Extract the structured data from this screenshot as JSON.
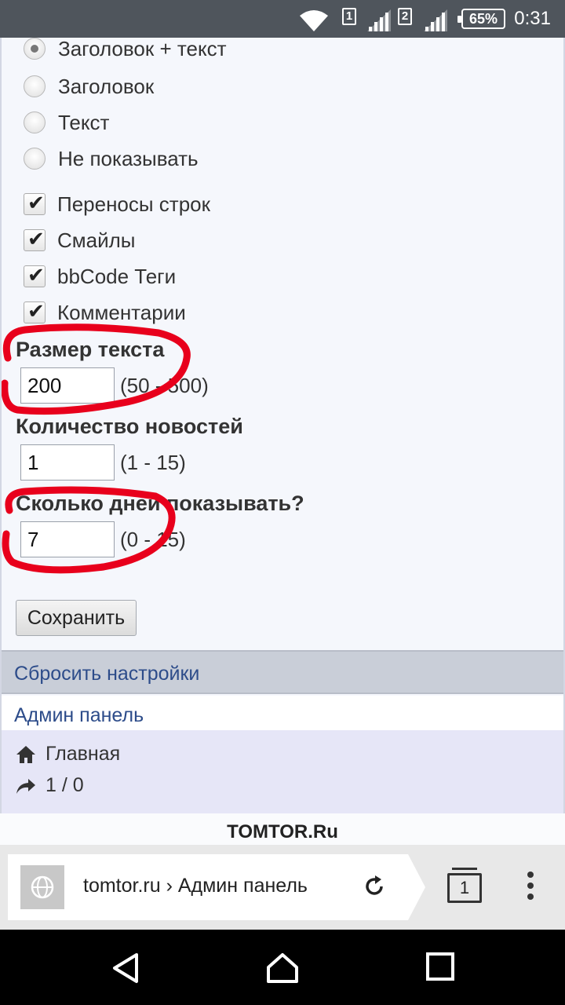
{
  "status_bar": {
    "time": "0:31",
    "battery": "65%",
    "sim1": "1",
    "sim2": "2"
  },
  "display_mode": {
    "options": [
      {
        "label": "Заголовок + текст",
        "checked": true
      },
      {
        "label": "Заголовок",
        "checked": false
      },
      {
        "label": "Текст",
        "checked": false
      },
      {
        "label": "Не показывать",
        "checked": false
      }
    ]
  },
  "options": {
    "items": [
      {
        "label": "Переносы строк",
        "checked": true
      },
      {
        "label": "Смайлы",
        "checked": true
      },
      {
        "label": "bbCode Теги",
        "checked": true
      },
      {
        "label": "Комментарии",
        "checked": true
      }
    ]
  },
  "text_size": {
    "label": "Размер текста",
    "value": "200",
    "range": "(50 - 500)"
  },
  "news_count": {
    "label": "Количество новостей",
    "value": "1",
    "range": "(1 - 15)"
  },
  "days_show": {
    "label": "Сколько дней показывать?",
    "value": "7",
    "range": "(0 - 15)"
  },
  "save_button": "Сохранить",
  "reset_link": "Сбросить настройки",
  "admin_link": "Админ панель",
  "footer": {
    "home": "Главная",
    "counter": "1 / 0"
  },
  "brand": "TOMTOR.Ru",
  "browser": {
    "url": "tomtor.ru › Админ панель",
    "tab_count": "1"
  },
  "colors": {
    "annotation": "#e8001c",
    "link": "#2d4c8a"
  }
}
